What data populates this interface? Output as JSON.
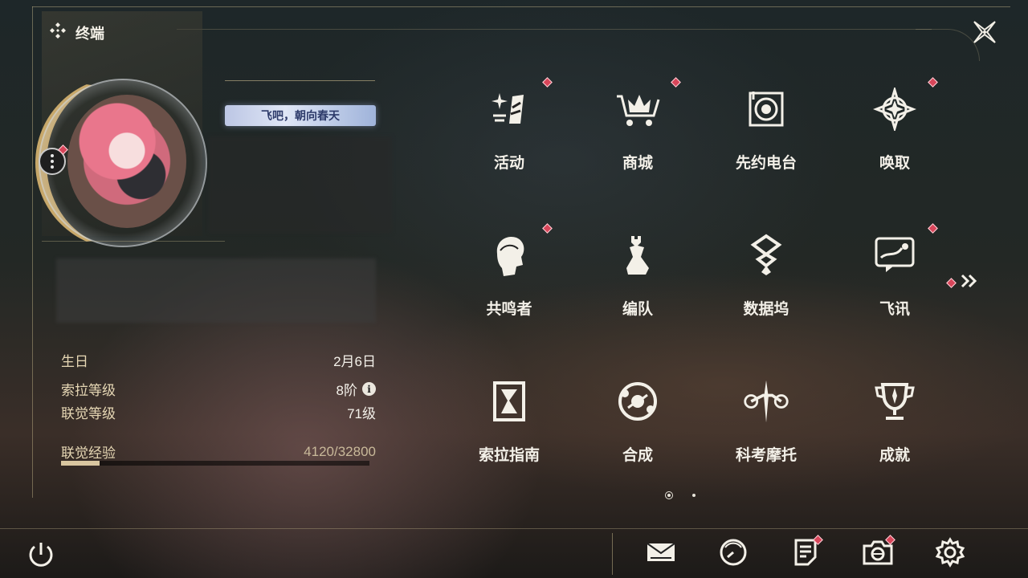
{
  "header": {
    "title": "终端",
    "icon": "diamond-cluster-icon",
    "close_icon": "close-x-icon"
  },
  "profile": {
    "title_badge": "飞吧，朝向春天",
    "avatar": "character-avatar",
    "stats": [
      {
        "label": "生日",
        "value": "2月6日"
      },
      {
        "label": "索拉等级",
        "value": "8阶",
        "info": "i"
      },
      {
        "label": "联觉等级",
        "value": "71级"
      }
    ],
    "exp": {
      "label": "联觉经验",
      "value": "4120/32800",
      "progress": 0.126
    }
  },
  "menu": {
    "items": [
      {
        "label": "活动",
        "icon": "sparkle-activity-icon",
        "badge": true
      },
      {
        "label": "商城",
        "icon": "shop-cart-icon",
        "badge": true
      },
      {
        "label": "先约电台",
        "icon": "radio-record-icon",
        "badge": false
      },
      {
        "label": "唤取",
        "icon": "compass-star-icon",
        "badge": true
      },
      {
        "label": "共鸣者",
        "icon": "character-profile-icon",
        "badge": true
      },
      {
        "label": "编队",
        "icon": "chess-team-icon",
        "badge": false
      },
      {
        "label": "数据坞",
        "icon": "data-dock-icon",
        "badge": false
      },
      {
        "label": "飞讯",
        "icon": "message-chat-icon",
        "badge": true
      },
      {
        "label": "索拉指南",
        "icon": "guide-book-icon",
        "badge": false
      },
      {
        "label": "合成",
        "icon": "synthesis-icon",
        "badge": false
      },
      {
        "label": "科考摩托",
        "icon": "motorbike-icon",
        "badge": false
      },
      {
        "label": "成就",
        "icon": "trophy-icon",
        "badge": false
      }
    ],
    "next_page_icon": "double-chevron-right-icon",
    "next_badge": true,
    "pages": 2,
    "current_page": 1
  },
  "bottom_bar": {
    "power_icon": "power-icon",
    "items": [
      {
        "icon": "mail-icon",
        "badge": false
      },
      {
        "icon": "clock-gauge-icon",
        "badge": false
      },
      {
        "icon": "notice-document-icon",
        "badge": true
      },
      {
        "icon": "camera-icon",
        "badge": true
      },
      {
        "icon": "settings-gear-icon",
        "badge": false
      }
    ]
  },
  "colors": {
    "badge_red": "#d8465a",
    "gold_accent": "#c8a86a",
    "text_light": "#f3f0e8",
    "label_tan": "#e7d8b5"
  }
}
